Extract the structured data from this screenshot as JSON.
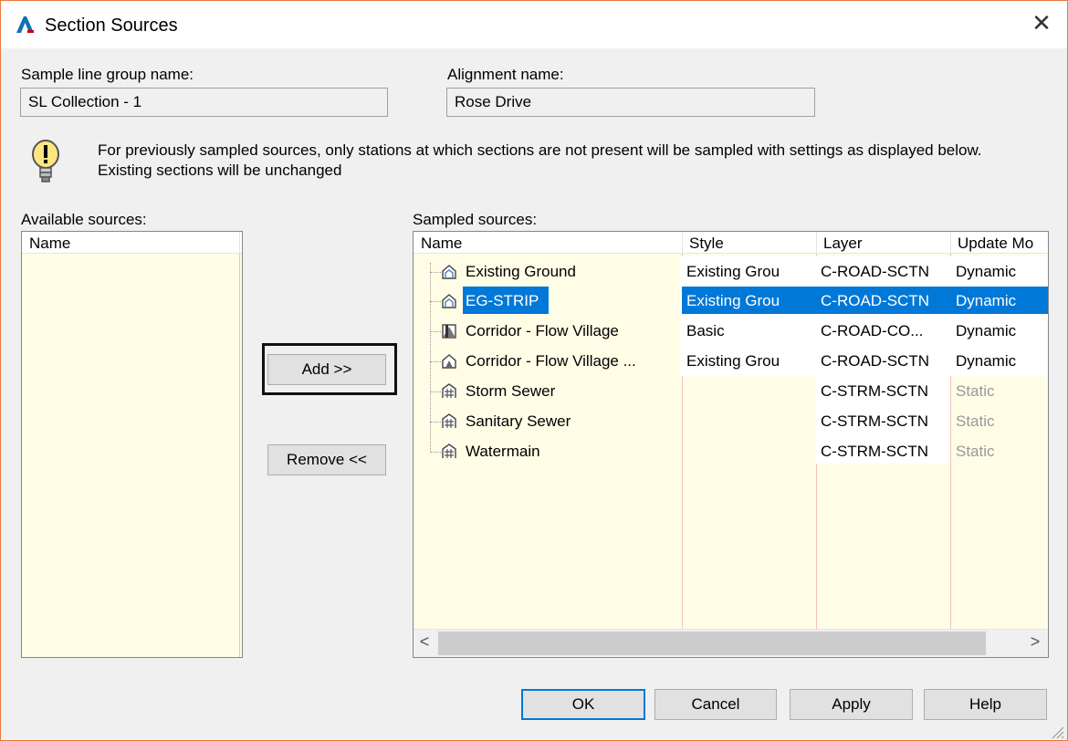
{
  "window": {
    "title": "Section Sources",
    "close_glyph": "✕"
  },
  "fields": {
    "sample_line_group_label": "Sample line group name:",
    "sample_line_group_value": "SL Collection - 1",
    "alignment_label": "Alignment name:",
    "alignment_value": "Rose Drive"
  },
  "info": {
    "icon": "lightbulb-icon",
    "message": "For previously sampled sources, only stations at which sections are not present will be sampled with settings as displayed below. Existing sections will be unchanged"
  },
  "available": {
    "label": "Available sources:",
    "columns": [
      "Name"
    ]
  },
  "sampled": {
    "label": "Sampled sources:",
    "columns": [
      "Name",
      "Style",
      "Layer",
      "Update Mo"
    ],
    "rows": [
      {
        "name": "Existing Ground",
        "icon": "surface-icon",
        "style": "Existing Grou",
        "layer": "C-ROAD-SCTN",
        "update": "Dynamic",
        "selected": false
      },
      {
        "name": "EG-STRIP",
        "icon": "surface-icon",
        "style": "Existing Grou",
        "layer": "C-ROAD-SCTN",
        "update": "Dynamic",
        "selected": true
      },
      {
        "name": "Corridor - Flow Village",
        "icon": "corridor-icon",
        "style": "Basic",
        "layer": "C-ROAD-CO...",
        "update": "Dynamic",
        "selected": false
      },
      {
        "name": "Corridor - Flow Village ...",
        "icon": "corridor-surface-icon",
        "style": "Existing Grou",
        "layer": "C-ROAD-SCTN",
        "update": "Dynamic",
        "selected": false
      },
      {
        "name": "Storm Sewer",
        "icon": "pipe-network-icon",
        "style": "",
        "layer": "C-STRM-SCTN",
        "update": "Static",
        "selected": false
      },
      {
        "name": "Sanitary Sewer",
        "icon": "pipe-network-icon",
        "style": "",
        "layer": "C-STRM-SCTN",
        "update": "Static",
        "selected": false
      },
      {
        "name": "Watermain",
        "icon": "pipe-network-icon",
        "style": "",
        "layer": "C-STRM-SCTN",
        "update": "Static",
        "selected": false
      }
    ]
  },
  "buttons": {
    "add": "Add >>",
    "remove": "Remove <<",
    "ok": "OK",
    "cancel": "Cancel",
    "apply": "Apply",
    "help": "Help"
  },
  "scroll": {
    "left_glyph": "<",
    "right_glyph": ">"
  },
  "colors": {
    "accent": "#0078d7",
    "list_bg": "#fffde6",
    "frame_border": "#e8793a"
  }
}
